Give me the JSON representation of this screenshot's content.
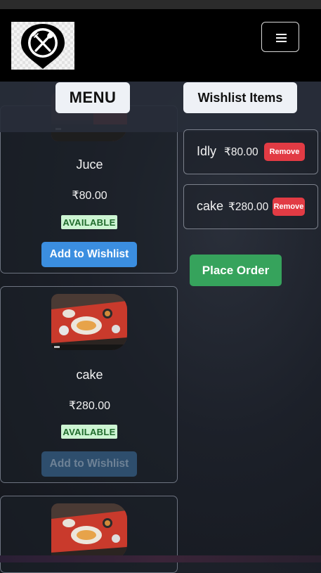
{
  "navbar": {
    "logo_icon": "fork-spoon-pin-icon",
    "menu_toggle_icon": "hamburger-icon"
  },
  "headers": {
    "menu": "MENU",
    "wishlist": "Wishlist Items"
  },
  "menu_items": [
    {
      "name": "Juce",
      "price": "₹80.00",
      "status": "AVAILABLE",
      "button": "Add to Wishlist",
      "button_enabled": true
    },
    {
      "name": "cake",
      "price": "₹280.00",
      "status": "AVAILABLE",
      "button": "Add to Wishlist",
      "button_enabled": false
    }
  ],
  "wishlist_items": [
    {
      "name": "Idly",
      "price": "₹80.00",
      "remove_label": "Remove"
    },
    {
      "name": "cake",
      "price": "₹280.00",
      "remove_label": "Remove"
    }
  ],
  "place_order_label": "Place Order",
  "colors": {
    "add_button": "#3b8ee0",
    "remove_button": "#e23b44",
    "place_order_button": "#36a35c",
    "available_badge": "#cdf5d3"
  }
}
